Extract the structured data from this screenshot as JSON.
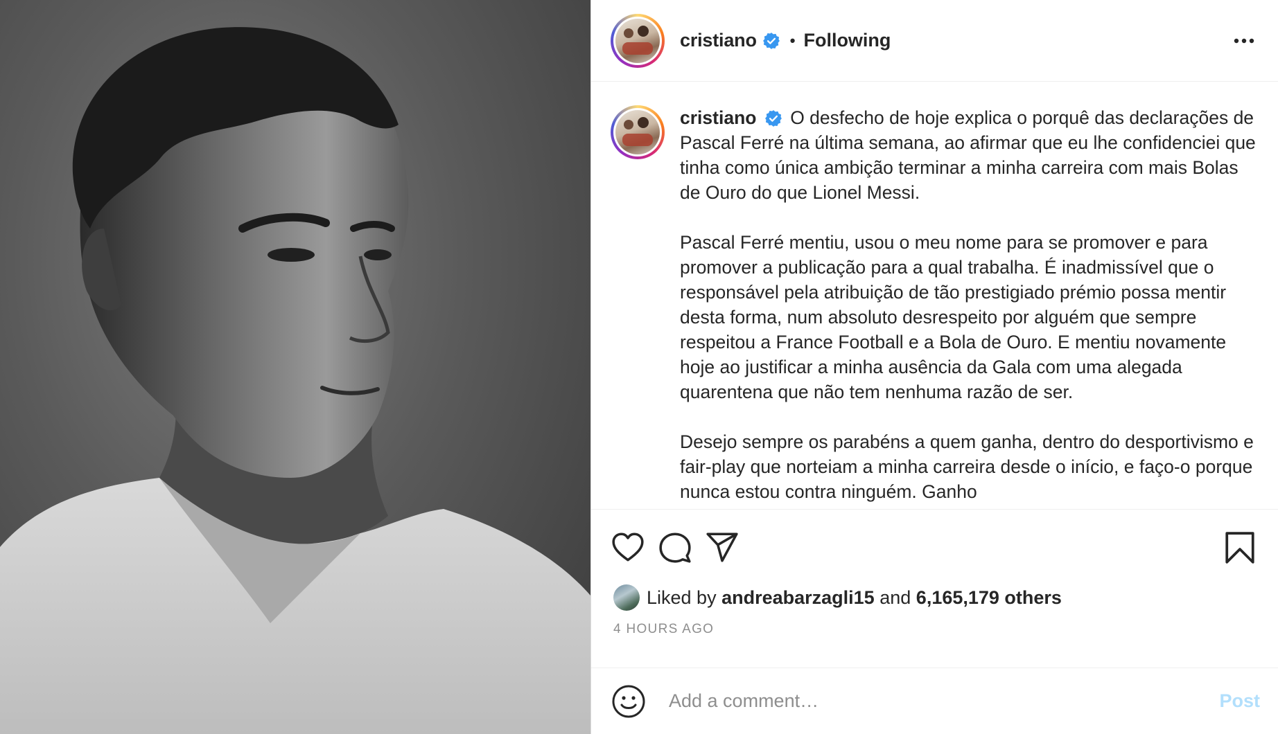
{
  "header": {
    "username": "cristiano",
    "separator": "•",
    "follow_status": "Following"
  },
  "caption": {
    "username": "cristiano",
    "paragraphs": [
      "O desfecho de hoje explica o porquê das declarações de Pascal Ferré na última semana, ao afirmar que eu lhe confidenciei que tinha como única ambição terminar a minha carreira com mais Bolas de Ouro do que Lionel Messi.",
      "Pascal Ferré mentiu, usou o meu nome para se promover e para promover a publicação para a qual trabalha. É inadmissível que o responsável pela atribuição de tão prestigiado prémio possa mentir desta forma, num absoluto desrespeito por alguém que sempre respeitou a France Football e a Bola de Ouro. E mentiu novamente hoje ao justificar a minha ausência da Gala com uma alegada quarentena que não tem nenhuma razão de ser.",
      "Desejo sempre os parabéns a quem ganha, dentro do desportivismo e fair-play que norteiam a minha carreira desde o início, e faço-o porque nunca estou contra ninguém. Ganho"
    ]
  },
  "likes": {
    "prefix": "Liked by",
    "liker": "andreabarzagli15",
    "conjunction": "and",
    "others": "6,165,179 others"
  },
  "timestamp": "4 HOURS AGO",
  "comment": {
    "placeholder": "Add a comment…",
    "post_label": "Post"
  },
  "colors": {
    "verified": "#3897f0",
    "post_button_disabled": "#b2dffc",
    "muted_text": "#8e8e8e"
  },
  "icons": [
    "more-options-icon",
    "heart-icon",
    "comment-icon",
    "share-icon",
    "bookmark-icon",
    "emoji-icon",
    "verified-badge-icon"
  ]
}
